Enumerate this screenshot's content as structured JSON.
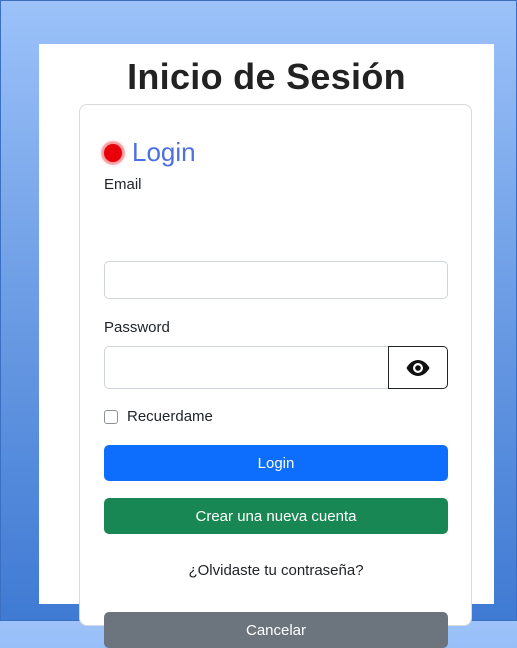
{
  "page": {
    "title": "Inicio de Sesión"
  },
  "card": {
    "title": "Login",
    "status_color": "#e8000b"
  },
  "email": {
    "label": "Email",
    "value": "",
    "placeholder": ""
  },
  "password": {
    "label": "Password",
    "value": "",
    "placeholder": "",
    "toggle_icon": "eye-icon"
  },
  "remember": {
    "label": "Recuerdame",
    "checked": false
  },
  "buttons": {
    "login": "Login",
    "create_account": "Crear una nueva cuenta",
    "cancel": "Cancelar"
  },
  "links": {
    "forgot_password": "¿Olvidaste tu contraseña?"
  },
  "colors": {
    "accent": "#4e6fe0",
    "primary": "#0d6efd",
    "success": "#198754",
    "secondary": "#6c757d"
  }
}
